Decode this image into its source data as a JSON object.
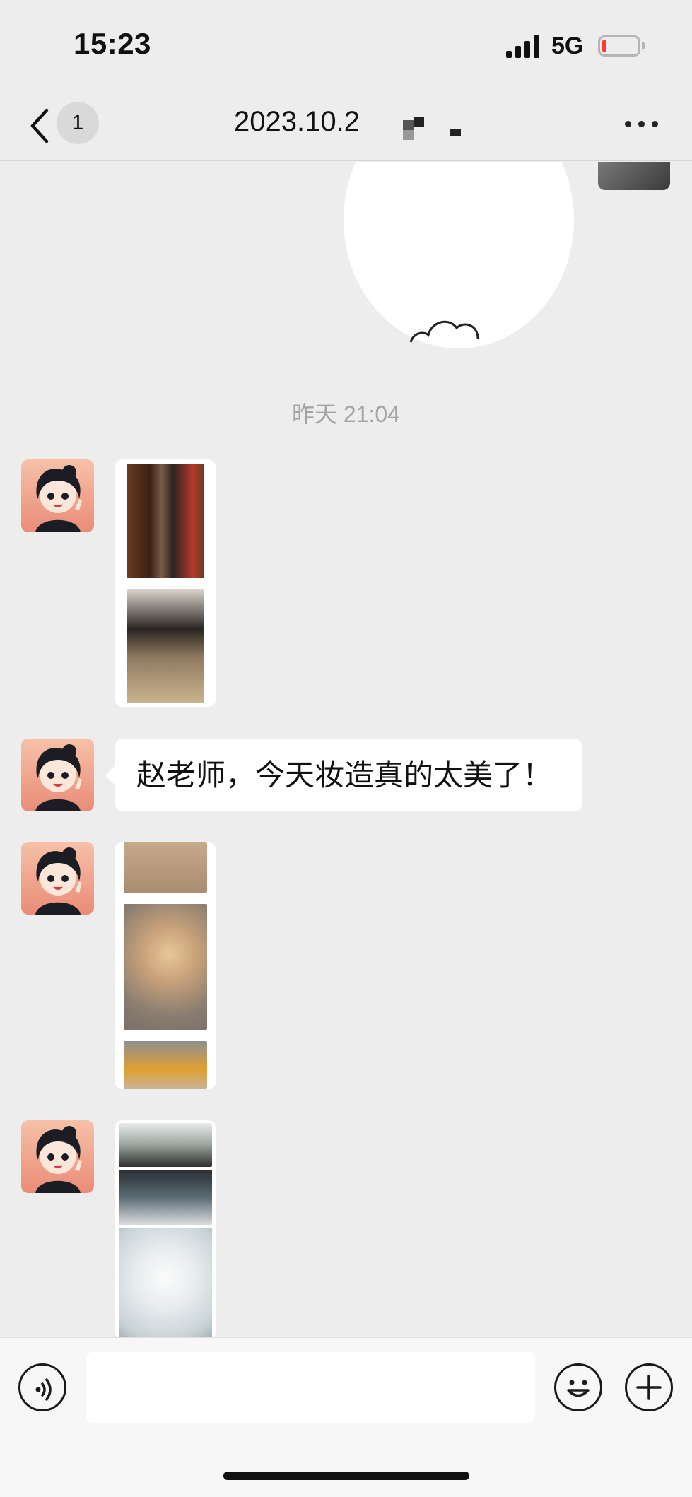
{
  "status_bar": {
    "time": "15:23",
    "network": "5G",
    "battery_level": 0.12,
    "battery_color": "#ff3b30"
  },
  "header": {
    "back_icon": "chevron-left-icon",
    "unread_count": "1",
    "title": "2023.10.2",
    "more_icon": "more-dots-icon"
  },
  "chat": {
    "timestamp": "昨天 21:04",
    "messages": [
      {
        "type": "image-collage",
        "sender": "contact"
      },
      {
        "type": "text",
        "sender": "contact",
        "text": "赵老师，今天妆造真的太美了！"
      },
      {
        "type": "image-collage",
        "sender": "contact"
      },
      {
        "type": "image-collage",
        "sender": "contact"
      }
    ]
  },
  "input_bar": {
    "voice_icon": "voice-icon",
    "input_value": "",
    "emoji_icon": "emoji-icon",
    "plus_icon": "plus-icon"
  },
  "colors": {
    "background": "#ededed",
    "bubble": "#ffffff",
    "timestamp_text": "#a3a3a3"
  }
}
